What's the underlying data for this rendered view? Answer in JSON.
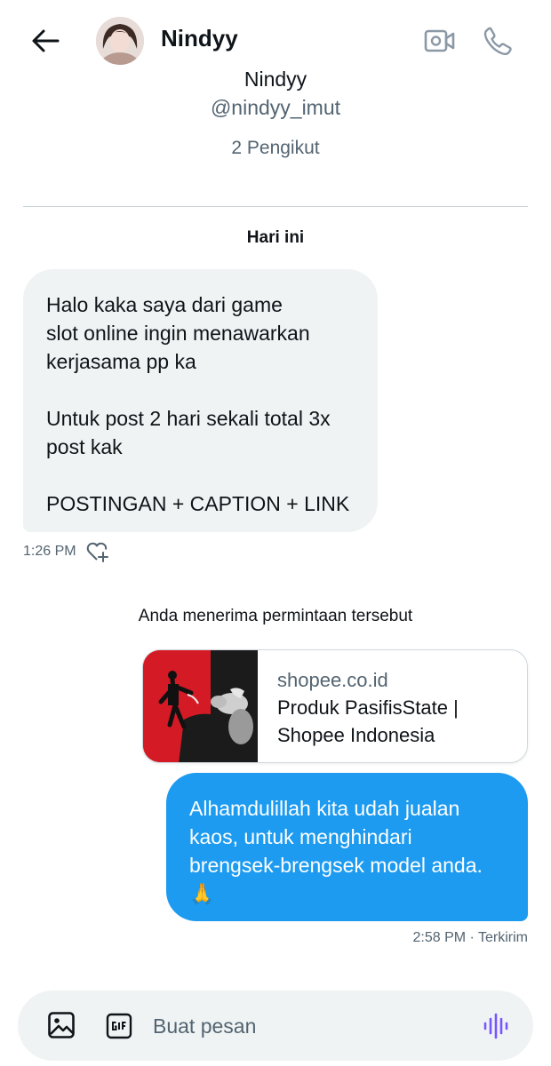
{
  "header": {
    "contact_name": "Nindyy"
  },
  "profile": {
    "name": "Nindyy",
    "handle": "@nindyy_imut",
    "followers": "2 Pengikut"
  },
  "conversation": {
    "date_label": "Hari ini",
    "incoming": {
      "text": "Halo kaka saya dari game\nslot online ingin menawarkan\nkerjasama pp ka\n\nUntuk post 2 hari sekali total 3x\npost kak\n\nPOSTINGAN + CAPTION + LINK",
      "time": "1:26 PM"
    },
    "system_message": "Anda menerima permintaan tersebut",
    "link_card": {
      "domain": "shopee.co.id",
      "title": "Produk PasifisState |\nShopee Indonesia"
    },
    "outgoing": {
      "text": "Alhamdulillah kita udah jualan kaos, untuk menghindari brengsek-brengsek model anda. 🙏",
      "status": "2:58 PM · Terkirim"
    }
  },
  "composer": {
    "placeholder": "Buat pesan"
  },
  "colors": {
    "accent_blue": "#1d9bf0",
    "bubble_grey": "#eff3f4",
    "secondary_text": "#536471",
    "voice_purple": "#7856ff"
  },
  "icons": [
    "back-arrow-icon",
    "video-call-icon",
    "phone-icon",
    "heart-plus-icon",
    "image-icon",
    "gif-icon",
    "voice-wave-icon"
  ]
}
